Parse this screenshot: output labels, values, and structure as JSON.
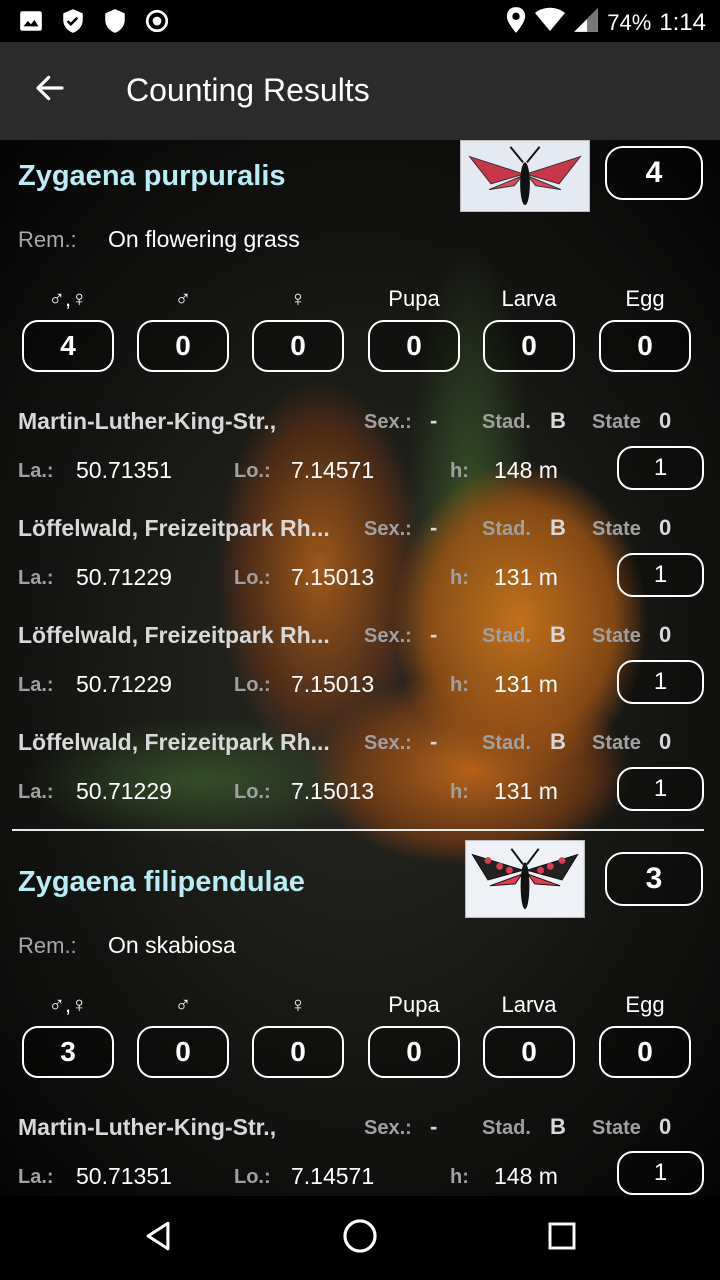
{
  "status_bar": {
    "icons_left": [
      "image-icon",
      "shield-check-icon",
      "shield-icon",
      "record-icon"
    ],
    "icons_right": [
      "location-icon",
      "wifi-icon",
      "signal-icon",
      "battery-icon"
    ],
    "battery": "74%",
    "time": "1:14"
  },
  "app_bar": {
    "back_icon": "arrow-left-icon",
    "title": "Counting Results",
    "background": "#2b2b2b"
  },
  "species": [
    {
      "name": "Zygaena purpuralis",
      "total": "4",
      "remark_label": "Rem.:",
      "remark": "On flowering grass",
      "stages": [
        {
          "label": "♂,♀",
          "value": "4"
        },
        {
          "label": "♂",
          "value": "0"
        },
        {
          "label": "♀",
          "value": "0"
        },
        {
          "label": "Pupa",
          "value": "0"
        },
        {
          "label": "Larva",
          "value": "0"
        },
        {
          "label": "Egg",
          "value": "0"
        }
      ],
      "records": [
        {
          "location": "Martin-Luther-King-Str.,",
          "sex_label": "Sex.:",
          "sex": "-",
          "stad_label": "Stad.",
          "stad": "B",
          "state_label": "State",
          "state": "0",
          "la_label": "La.:",
          "la": "50.71351",
          "lo_label": "Lo.:",
          "lo": "7.14571",
          "h_label": "h:",
          "h": "148 m",
          "count": "1"
        },
        {
          "location": "Löffelwald, Freizeitpark Rh...",
          "sex_label": "Sex.:",
          "sex": "-",
          "stad_label": "Stad.",
          "stad": "B",
          "state_label": "State",
          "state": "0",
          "la_label": "La.:",
          "la": "50.71229",
          "lo_label": "Lo.:",
          "lo": "7.15013",
          "h_label": "h:",
          "h": "131 m",
          "count": "1"
        },
        {
          "location": "Löffelwald, Freizeitpark Rh...",
          "sex_label": "Sex.:",
          "sex": "-",
          "stad_label": "Stad.",
          "stad": "B",
          "state_label": "State",
          "state": "0",
          "la_label": "La.:",
          "la": "50.71229",
          "lo_label": "Lo.:",
          "lo": "7.15013",
          "h_label": "h:",
          "h": "131 m",
          "count": "1"
        },
        {
          "location": "Löffelwald, Freizeitpark Rh...",
          "sex_label": "Sex.:",
          "sex": "-",
          "stad_label": "Stad.",
          "stad": "B",
          "state_label": "State",
          "state": "0",
          "la_label": "La.:",
          "la": "50.71229",
          "lo_label": "Lo.:",
          "lo": "7.15013",
          "h_label": "h:",
          "h": "131 m",
          "count": "1"
        }
      ]
    },
    {
      "name": "Zygaena filipendulae",
      "total": "3",
      "remark_label": "Rem.:",
      "remark": "On skabiosa",
      "stages": [
        {
          "label": "♂,♀",
          "value": "3"
        },
        {
          "label": "♂",
          "value": "0"
        },
        {
          "label": "♀",
          "value": "0"
        },
        {
          "label": "Pupa",
          "value": "0"
        },
        {
          "label": "Larva",
          "value": "0"
        },
        {
          "label": "Egg",
          "value": "0"
        }
      ],
      "records": [
        {
          "location": "Martin-Luther-King-Str.,",
          "sex_label": "Sex.:",
          "sex": "-",
          "stad_label": "Stad.",
          "stad": "B",
          "state_label": "State",
          "state": "0",
          "la_label": "La.:",
          "la": "50.71351",
          "lo_label": "Lo.:",
          "lo": "7.14571",
          "h_label": "h:",
          "h": "148 m",
          "count": "1"
        }
      ]
    }
  ],
  "nav_bar": {
    "icons": [
      "back-triangle-icon",
      "home-circle-icon",
      "recents-square-icon"
    ]
  },
  "colors": {
    "species_name": "#b9ecf5",
    "label_gray": "#a0a0a0"
  }
}
